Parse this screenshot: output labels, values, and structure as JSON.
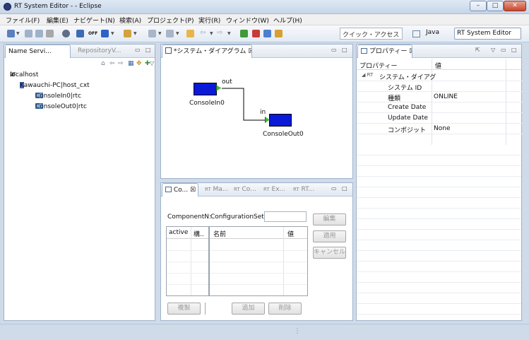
{
  "window": {
    "title": "RT System Editor - - Eclipse",
    "min": "–",
    "max": "□",
    "close": "✕"
  },
  "menu": [
    "ファイル(F)",
    "編集(E)",
    "ナビゲート(N)",
    "検索(A)",
    "プロジェクト(P)",
    "実行(R)",
    "ウィンドウ(W)",
    "ヘルプ(H)"
  ],
  "toolbar": {
    "quick_access": "クイック・アクセス",
    "perspectives": [
      {
        "label": "Java"
      },
      {
        "label": "RT System Editor"
      }
    ],
    "off_label": "OFF"
  },
  "name_service": {
    "tabs": [
      {
        "label": "Name Servi..."
      },
      {
        "label": "RepositoryV..."
      }
    ],
    "tree": [
      {
        "label": "localhost",
        "prefix": "RT"
      },
      {
        "label": "Kawauchi-PC|host_cxt"
      },
      {
        "label": "ConsoleIn0|rtc"
      },
      {
        "label": "ConsoleOut0|rtc"
      }
    ]
  },
  "diagram": {
    "tab": "*システム・ダイアグラム",
    "components": [
      {
        "name": "ConsoleIn0",
        "port": "out"
      },
      {
        "name": "ConsoleOut0",
        "port": "in"
      }
    ]
  },
  "config": {
    "tabs": [
      {
        "label": "Co..."
      },
      {
        "label": "Ma..."
      },
      {
        "label": "Co..."
      },
      {
        "label": "Ex..."
      },
      {
        "label": "RT..."
      }
    ],
    "component_name_label": "ComponentN:",
    "config_set_label": "ConfigurationSet:",
    "left_cols": [
      "active",
      "構.."
    ],
    "right_cols": [
      "名前",
      "値"
    ],
    "buttons": {
      "edit": "編集",
      "apply": "適用",
      "cancel": "キャンセル",
      "copy": "複製",
      "add": "追加",
      "delete": "削除"
    }
  },
  "properties": {
    "tab": "プロパティー",
    "col_property": "プロパティー",
    "col_value": "値",
    "group": "システム・ダイアグ",
    "rows": [
      {
        "key": "システム ID",
        "value": ""
      },
      {
        "key": "種類",
        "value": "ONLINE"
      },
      {
        "key": "Create Date",
        "value": ""
      },
      {
        "key": "Update Date",
        "value": ""
      },
      {
        "key": "コンポジット",
        "value": "None"
      }
    ]
  },
  "colors": {
    "component_fill": "#0a1ad8",
    "port_fill": "#3fbf2f",
    "frame": "#cfdbe9"
  }
}
